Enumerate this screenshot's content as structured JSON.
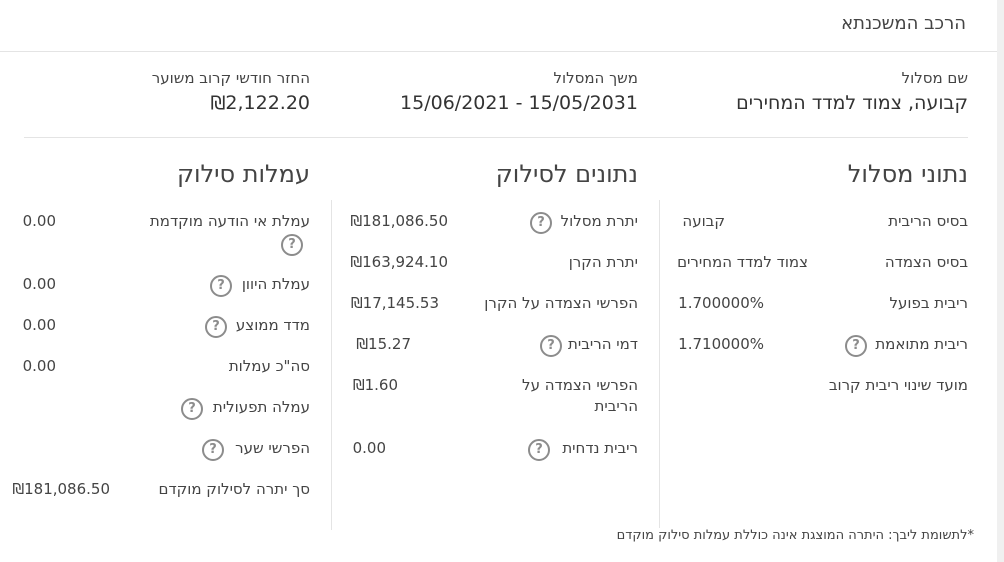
{
  "header": {
    "title": "הרכב המשכנתא"
  },
  "summary": {
    "track_name_label": "שם מסלול",
    "track_name_value": "קבועה, צמוד למדד המחירים",
    "duration_label": "משך המסלול",
    "duration_value": "15/06/2021 - 15/05/2031",
    "monthly_label": "החזר חודשי קרוב משוער",
    "monthly_value": "₪2,122.20"
  },
  "track_details": {
    "title": "נתוני מסלול",
    "rows": [
      {
        "label": "בסיס הריבית",
        "value": "קבועה",
        "help": false
      },
      {
        "label": "בסיס הצמדה",
        "value": "צמוד למדד המחירים",
        "help": false
      },
      {
        "label": "ריבית בפועל",
        "value": "1.700000%",
        "help": false
      },
      {
        "label": "ריבית מתואמת",
        "value": "1.710000%",
        "help": true
      },
      {
        "label": "מועד שינוי ריבית קרוב",
        "value": "",
        "help": false
      }
    ]
  },
  "payoff_data": {
    "title": "נתונים לסילוק",
    "rows": [
      {
        "label": "יתרת מסלול",
        "value": "₪181,086.50",
        "help": true
      },
      {
        "label": "יתרת הקרן",
        "value": "₪163,924.10",
        "help": false
      },
      {
        "label": "הפרשי הצמדה על הקרן",
        "value": "₪17,145.53",
        "help": false
      },
      {
        "label": "דמי הריבית",
        "value": "₪15.27",
        "help": true
      },
      {
        "label": "הפרשי הצמדה על הריבית",
        "value": "₪1.60",
        "help": false
      },
      {
        "label": "ריבית נדחית",
        "value": "0.00",
        "help": true
      }
    ]
  },
  "payoff_fees": {
    "title": "עמלות סילוק",
    "rows": [
      {
        "label": "עמלת אי הודעה מוקדמת",
        "value": "0.00",
        "help": true
      },
      {
        "label": "עמלת היוון",
        "value": "0.00",
        "help": true
      },
      {
        "label": "מדד ממוצע",
        "value": "0.00",
        "help": true
      },
      {
        "label": "סה\"כ עמלות",
        "value": "0.00",
        "help": false
      },
      {
        "label": "עמלה תפעולית",
        "value": "",
        "help": true
      },
      {
        "label": "הפרשי שער",
        "value": "",
        "help": true
      },
      {
        "label": "סך יתרה לסילוק מוקדם",
        "value": "₪181,086.50",
        "help": false
      }
    ]
  },
  "icons": {
    "help": "question-mark-icon",
    "help_glyph": "?"
  },
  "footnote": "*לתשומת ליבך: היתרה המוצגת אינה כוללת עמלות סילוק מוקדם"
}
